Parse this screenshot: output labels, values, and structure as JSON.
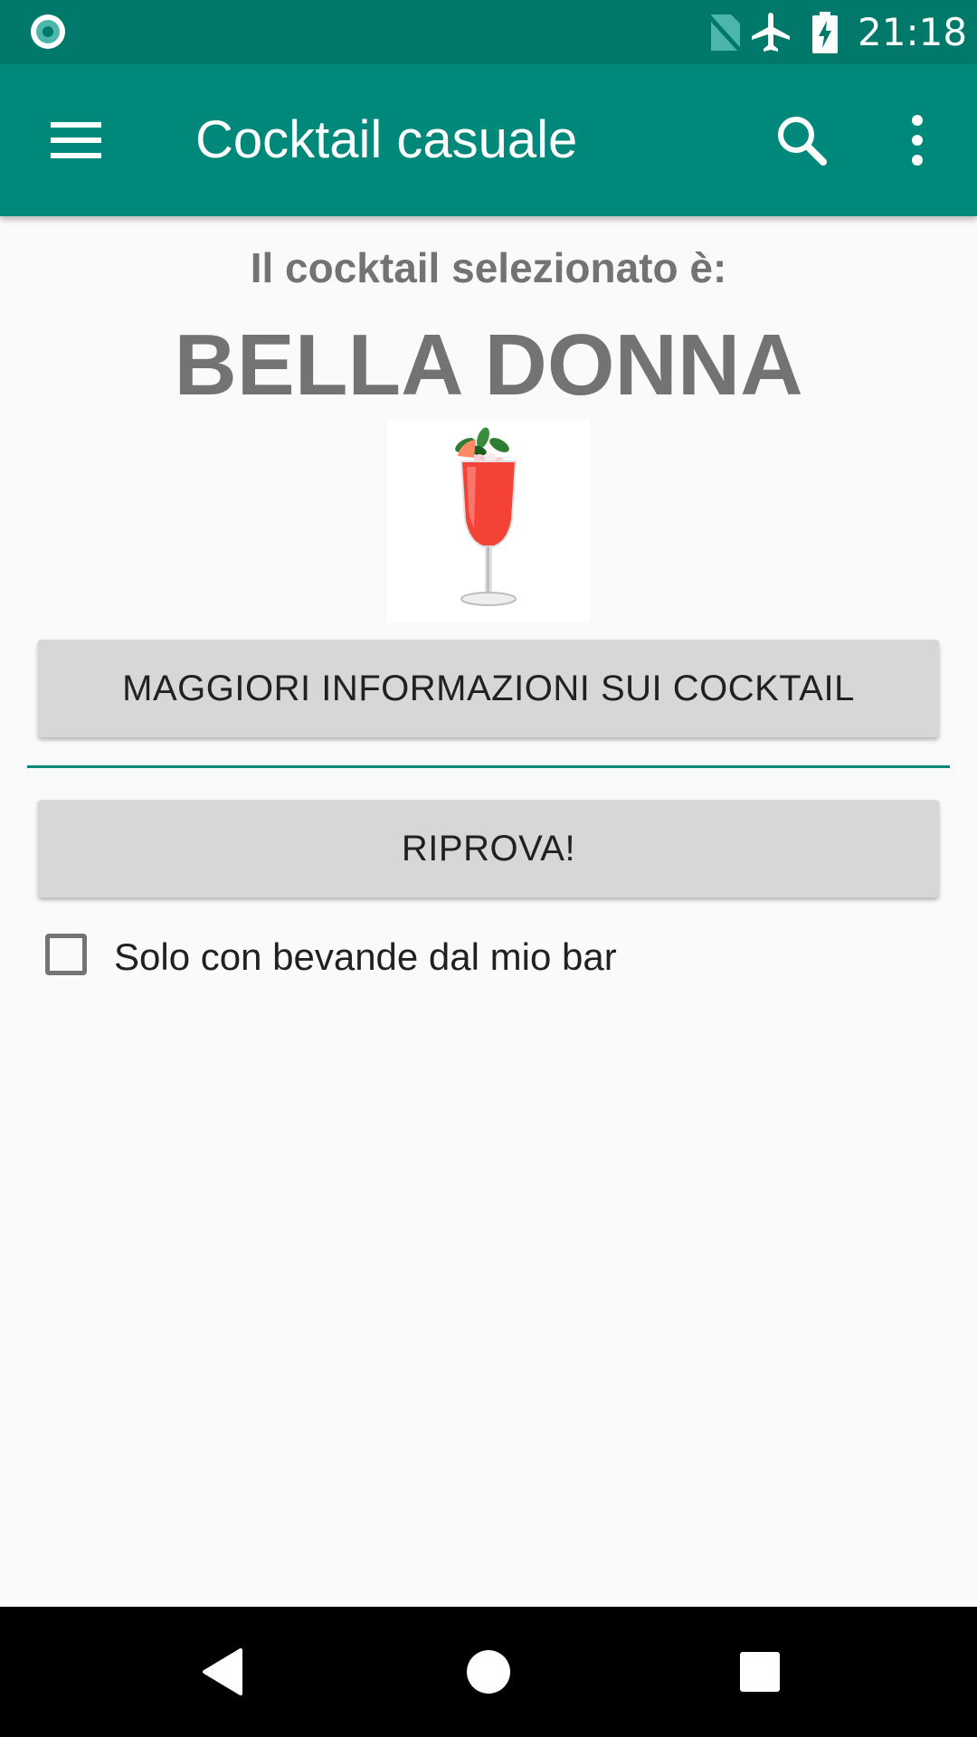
{
  "status_bar": {
    "time": "21:18",
    "icons": [
      "app-notification-icon",
      "no-sim-icon",
      "airplane-mode-icon",
      "battery-charging-icon"
    ]
  },
  "app_bar": {
    "title": "Cocktail casuale",
    "icons": [
      "menu-icon",
      "search-icon",
      "more-vert-icon"
    ]
  },
  "main": {
    "subtitle": "Il cocktail selezionato è:",
    "cocktail_name": "BELLA DONNA",
    "info_button_label": "MAGGIORI INFORMAZIONI SUI COCKTAIL",
    "retry_button_label": "RIPROVA!",
    "checkbox_label": "Solo con bevande dal mio bar",
    "checkbox_checked": false
  },
  "nav_bar": {
    "icons": [
      "back-icon",
      "home-icon",
      "recents-icon"
    ]
  },
  "colors": {
    "status_bar": "#00796b",
    "app_bar": "#00897b",
    "accent": "#00897b",
    "background": "#fafafa",
    "button": "#d6d7d7",
    "secondary_text": "#737373"
  }
}
